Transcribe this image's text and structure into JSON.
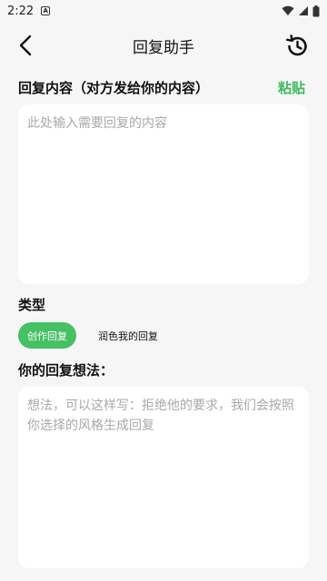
{
  "status_bar": {
    "time": "2:22",
    "notif_badge": "A"
  },
  "header": {
    "title": "回复助手"
  },
  "reply_content": {
    "label": "回复内容（对方发给你的内容）",
    "paste_label": "粘贴",
    "placeholder": "此处输入需要回复的内容",
    "value": ""
  },
  "type_section": {
    "label": "类型",
    "options": [
      "创作回复",
      "润色我的回复"
    ],
    "selected": "创作回复"
  },
  "idea_section": {
    "label": "你的回复想法：",
    "placeholder": "想法，可以这样写：拒绝他的要求，我们会按照你选择的风格生成回复",
    "value": ""
  },
  "colors": {
    "accent": "#45c063",
    "background": "#f6f6f6",
    "card": "#ffffff"
  }
}
